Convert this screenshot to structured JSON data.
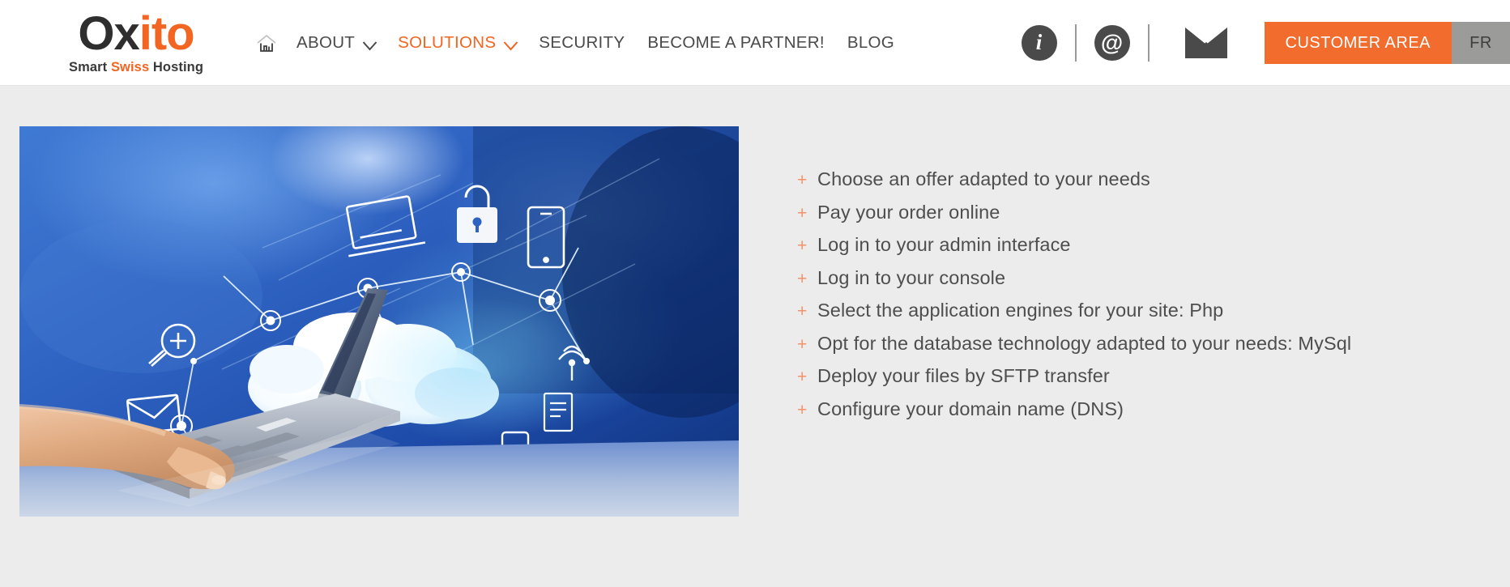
{
  "header": {
    "logo": {
      "text_dark": "Ox",
      "text_orange": "ito",
      "tagline_pre": "Smart ",
      "tagline_accent": "Swiss",
      "tagline_post": " Hosting"
    },
    "home_icon": "home-icon",
    "nav": [
      {
        "label": "ABOUT",
        "accent": false,
        "has_chevron": true
      },
      {
        "label": "SOLUTIONS",
        "accent": true,
        "has_chevron": true
      },
      {
        "label": "SECURITY",
        "accent": false,
        "has_chevron": false
      },
      {
        "label": "BECOME A PARTNER!",
        "accent": false,
        "has_chevron": false
      },
      {
        "label": "BLOG",
        "accent": false,
        "has_chevron": false
      }
    ],
    "icons": [
      {
        "name": "info-icon",
        "glyph": "i"
      },
      {
        "name": "at-icon",
        "glyph": "@"
      },
      {
        "name": "envelope-icon",
        "glyph": "envelope"
      }
    ],
    "customer_area_label": "CUSTOMER AREA",
    "language_label": "FR",
    "colors": {
      "accent_orange": "#f26522",
      "button_orange": "#f26c2e",
      "language_gray": "#9b9b99",
      "icon_dark": "#4a4a4a",
      "page_background": "#ececec"
    }
  },
  "main": {
    "hero_image_alt": "Hand pointing at laptop with cloud computing network illustration",
    "bullet_marker": "+",
    "bullets": [
      "Choose an offer adapted to your needs",
      "Pay your order online",
      "Log in to your admin interface",
      "Log in to your console",
      "Select the application engines for your site: Php",
      "Opt for the database technology adapted to your needs: MySql",
      "Deploy your files by SFTP transfer",
      "Configure your domain name (DNS)"
    ]
  }
}
